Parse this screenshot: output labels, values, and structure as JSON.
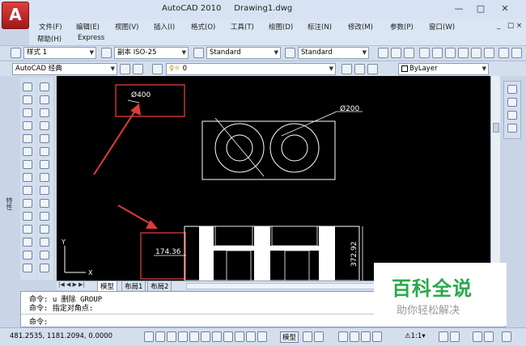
{
  "window": {
    "app_logo": "A",
    "title": "AutoCAD 2010     Drawing1.dwg",
    "minimize": "—",
    "maximize": "□",
    "close": "✕"
  },
  "menu": {
    "items": [
      "文件(F)",
      "编辑(E)",
      "视图(V)",
      "插入(I)",
      "格式(O)",
      "工具(T)",
      "绘图(D)",
      "标注(N)",
      "修改(M)",
      "参数(P)",
      "窗口(W)"
    ],
    "row2": [
      "帮助(H)",
      "Express"
    ],
    "mdi_buttons": [
      "_",
      "□",
      "×"
    ]
  },
  "toolbar1": {
    "text_style": "样式 1",
    "dim_style": "副本 ISO-25",
    "table_style": "Standard",
    "multileader_style": "Standard"
  },
  "toolbar2": {
    "workspace": "AutoCAD 经典",
    "layer": "0",
    "color": "ByLayer"
  },
  "drawing": {
    "dim_400": "Ø400",
    "dim_200": "Ø200",
    "dim_174": "174.36",
    "dim_372": "372.92",
    "ucs_x": "X",
    "ucs_y": "Y"
  },
  "left_panel": {
    "properties_label": "特性"
  },
  "layout_tabs": {
    "tabs": [
      "模型",
      "布局1",
      "布局2"
    ]
  },
  "command": {
    "lines": [
      "命令:  u 删除 GROUP",
      "命令: 指定对角点:",
      "命令:"
    ]
  },
  "watermark": {
    "title": "百科全说",
    "subtitle": "助你轻松解决"
  },
  "status": {
    "coords": "481.2535,  1181.2094,  0.0000",
    "model": "模型",
    "scale": "1:1"
  }
}
